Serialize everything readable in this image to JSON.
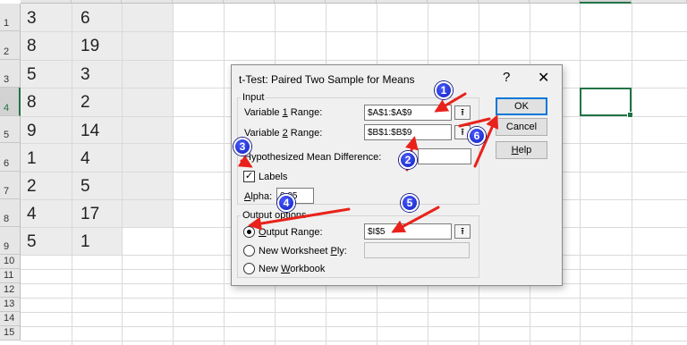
{
  "sheet": {
    "row_numbers": [
      "1",
      "2",
      "3",
      "4",
      "5",
      "6",
      "7",
      "8",
      "9",
      "10",
      "11",
      "12",
      "13",
      "14",
      "15"
    ],
    "col_a": [
      "3",
      "8",
      "5",
      "8",
      "9",
      "1",
      "2",
      "4",
      "5"
    ],
    "col_b": [
      "6",
      "19",
      "3",
      "2",
      "14",
      "4",
      "5",
      "17",
      "1"
    ]
  },
  "dialog": {
    "title": "t-Test: Paired Two Sample for Means",
    "help_glyph": "?",
    "close_glyph": "✕",
    "input_group": "Input",
    "var1_label_pre": "Variable ",
    "var1_label_u": "1",
    "var1_label_post": " Range:",
    "var1_value": "$A$1:$A$9",
    "var2_label_pre": "Variable ",
    "var2_label_u": "2",
    "var2_label_post": " Range:",
    "var2_value": "$B$1:$B$9",
    "hyp_label": "Hypothesized Mean Difference:",
    "hyp_value": "",
    "labels_label": "Labels",
    "labels_checked": true,
    "alpha_label_u": "A",
    "alpha_label_post": "lpha:",
    "alpha_value": "0.05",
    "output_group": "Output options",
    "output_range_label_u": "O",
    "output_range_label_post": "utput Range:",
    "output_range_value": "$I$5",
    "new_ply_label_pre": "New Worksheet ",
    "new_ply_label_u": "P",
    "new_ply_label_post": "ly:",
    "new_wb_label_pre": "New ",
    "new_wb_label_u": "W",
    "new_wb_label_post": "orkbook",
    "ok_label": "OK",
    "cancel_label": "Cancel",
    "help_label_u": "H",
    "help_label_post": "elp",
    "collapse_glyph": "⭱"
  },
  "annotations": {
    "badges": [
      "1",
      "2",
      "3",
      "4",
      "5",
      "6"
    ],
    "arrow_color": "#e8221b",
    "badge_color": "#1f33d9"
  },
  "colors": {
    "accent": "#217346",
    "default_button": "#0078d7"
  }
}
